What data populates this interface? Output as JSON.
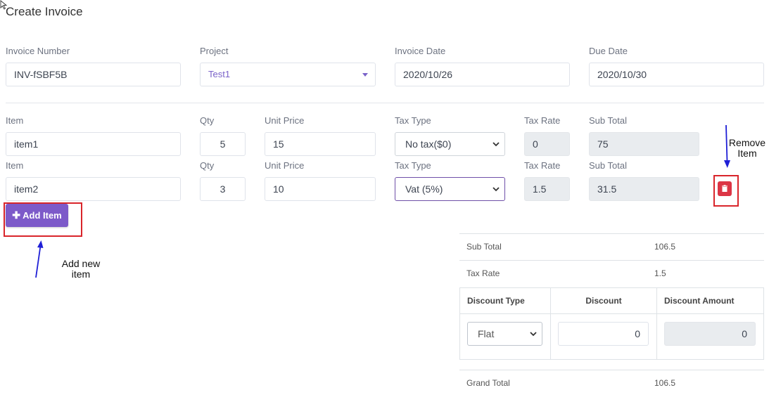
{
  "page": {
    "title": "Create Invoice"
  },
  "invoice": {
    "number_label": "Invoice Number",
    "number_value": "INV-fSBF5B",
    "project_label": "Project",
    "project_value": "Test1",
    "date_label": "Invoice Date",
    "date_value": "2020/10/26",
    "due_label": "Due Date",
    "due_value": "2020/10/30"
  },
  "item_labels": {
    "item": "Item",
    "qty": "Qty",
    "unit_price": "Unit Price",
    "tax_type": "Tax Type",
    "tax_rate": "Tax Rate",
    "sub_total": "Sub Total"
  },
  "items": [
    {
      "item": "item1",
      "qty": "5",
      "unit_price": "15",
      "tax_type": "No tax($0)",
      "tax_rate": "0",
      "sub_total": "75"
    },
    {
      "item": "item2",
      "qty": "3",
      "unit_price": "10",
      "tax_type": "Vat (5%)",
      "tax_rate": "1.5",
      "sub_total": "31.5"
    }
  ],
  "buttons": {
    "add_item": "Add Item"
  },
  "annotations": {
    "remove_line1": "Remove",
    "remove_line2": "Item",
    "add_line1": "Add new",
    "add_line2": "item"
  },
  "summary": {
    "sub_total_label": "Sub Total",
    "sub_total_value": "106.5",
    "tax_rate_label": "Tax Rate",
    "tax_rate_value": "1.5",
    "discount_type_header": "Discount Type",
    "discount_header": "Discount",
    "discount_amount_header": "Discount Amount",
    "discount_type_value": "Flat",
    "discount_value": "0",
    "discount_amount_value": "0",
    "grand_total_label": "Grand Total",
    "grand_total_value": "106.5"
  },
  "colors": {
    "accent": "#7d5ac9",
    "danger": "#dc3545",
    "annotation_arrow": "#1f1fd6",
    "annotation_box": "#d9252b"
  },
  "icons": {
    "add": "plus-icon",
    "remove": "trash-icon",
    "select": "chevron-down-icon"
  }
}
